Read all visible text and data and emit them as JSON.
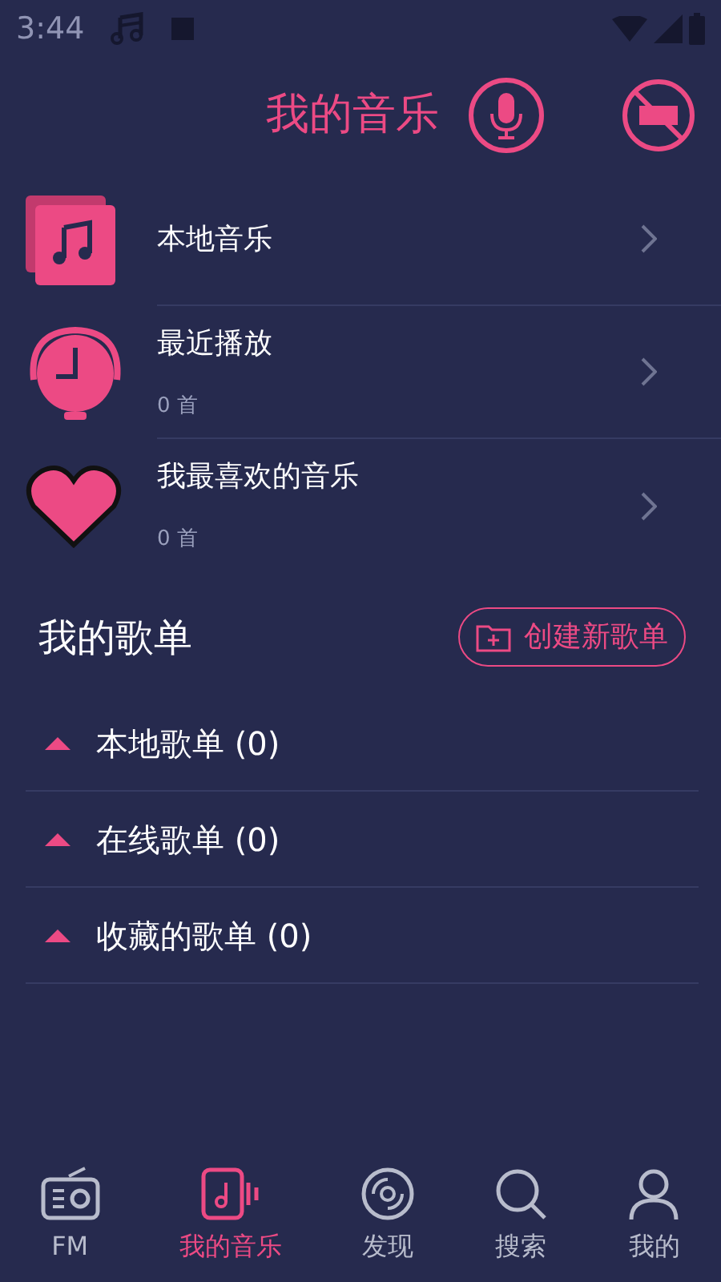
{
  "status_bar": {
    "time": "3:44"
  },
  "header": {
    "title": "我的音乐"
  },
  "library": [
    {
      "kind": "local",
      "title": "本地音乐"
    },
    {
      "kind": "recent",
      "title": "最近播放",
      "count": "0 首"
    },
    {
      "kind": "favorite",
      "title": "我最喜欢的音乐",
      "count": "0 首"
    }
  ],
  "playlists_section": {
    "title": "我的歌单",
    "create_button": "创建新歌单"
  },
  "playlist_groups": [
    {
      "label": "本地歌单 (0)",
      "expanded": true
    },
    {
      "label": "在线歌单 (0)",
      "expanded": true
    },
    {
      "label": "收藏的歌单 (0)",
      "expanded": true
    }
  ],
  "bottom_nav": [
    {
      "kind": "fm",
      "label": "FM",
      "selected": false
    },
    {
      "kind": "music",
      "label": "我的音乐",
      "selected": true
    },
    {
      "kind": "discover",
      "label": "发现",
      "selected": false
    },
    {
      "kind": "search",
      "label": "搜索",
      "selected": false
    },
    {
      "kind": "me",
      "label": "我的",
      "selected": false
    }
  ]
}
